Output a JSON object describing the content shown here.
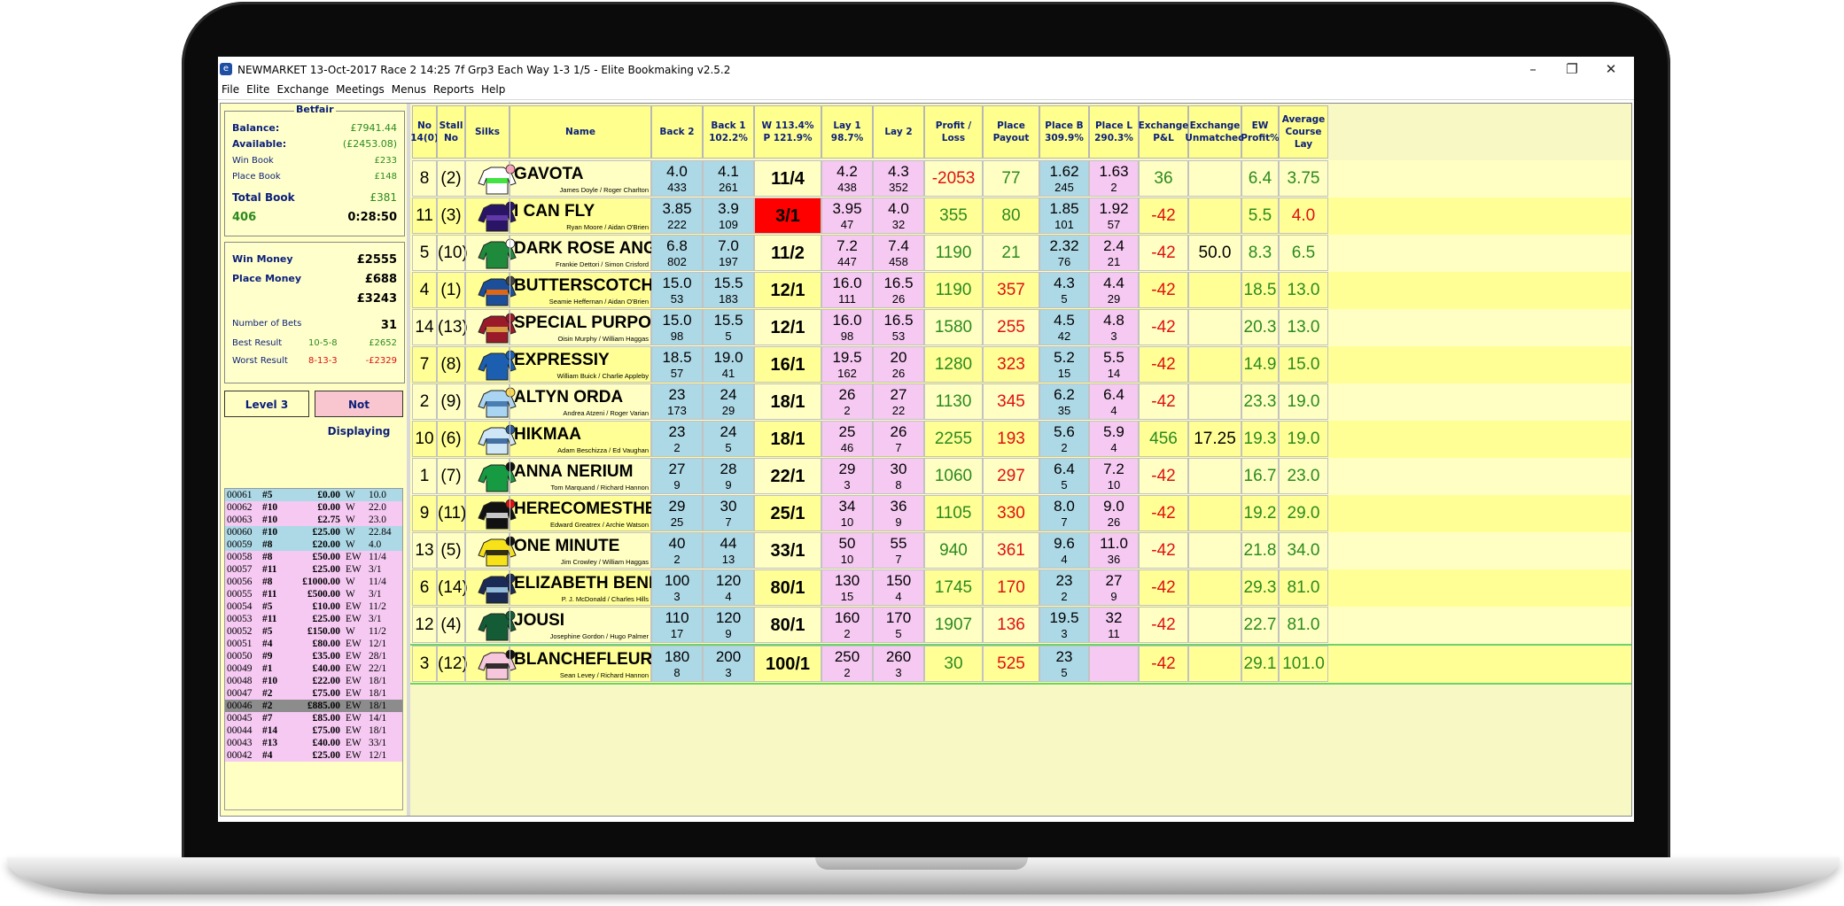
{
  "window": {
    "title": "NEWMARKET 13-Oct-2017 Race 2 14:25 7f Grp3 Each Way 1-3 1/5 - Elite Bookmaking v2.5.2",
    "minimize": "–",
    "restore": "❐",
    "close": "✕"
  },
  "menu": [
    "File",
    "Elite",
    "Exchange",
    "Meetings",
    "Menus",
    "Reports",
    "Help"
  ],
  "betfair": {
    "legend": "Betfair",
    "balance_label": "Balance:",
    "balance": "£7941.44",
    "available_label": "Available:",
    "available": "(£2453.08)",
    "winbook_label": "Win Book",
    "winbook": "£233",
    "placebook_label": "Place Book",
    "placebook": "£148",
    "totalbook_label": "Total Book",
    "totalbook": "£381",
    "count": "406",
    "timer": "0:28:50"
  },
  "money": {
    "win_label": "Win Money",
    "win": "£2555",
    "place_label": "Place Money",
    "place": "£688",
    "total": "£3243",
    "bets_label": "Number of Bets",
    "bets": "31",
    "best_label": "Best Result",
    "best_combo": "10-5-8",
    "best": "£2652",
    "worst_label": "Worst Result",
    "worst_combo": "8-13-3",
    "worst": "-£2329"
  },
  "buttons": {
    "level": "Level 3",
    "display": "Not Displaying"
  },
  "bets": [
    {
      "id": "00061",
      "h": "#5",
      "amt": "£0.00",
      "t": "W",
      "o": "10.0",
      "bg": "#add8e6"
    },
    {
      "id": "00062",
      "h": "#10",
      "amt": "£0.00",
      "t": "W",
      "o": "22.0",
      "bg": "#f5c9f2"
    },
    {
      "id": "00063",
      "h": "#10",
      "amt": "£2.75",
      "t": "W",
      "o": "23.0",
      "bg": "#f5c9f2"
    },
    {
      "id": "00060",
      "h": "#10",
      "amt": "£25.00",
      "t": "W",
      "o": "22.84",
      "bg": "#add8e6"
    },
    {
      "id": "00059",
      "h": "#8",
      "amt": "£20.00",
      "t": "W",
      "o": "4.0",
      "bg": "#add8e6"
    },
    {
      "id": "00058",
      "h": "#8",
      "amt": "£50.00",
      "t": "EW",
      "o": "11/4",
      "bg": "#f5c9f2"
    },
    {
      "id": "00057",
      "h": "#11",
      "amt": "£25.00",
      "t": "EW",
      "o": "3/1",
      "bg": "#f5c9f2"
    },
    {
      "id": "00056",
      "h": "#8",
      "amt": "£1000.00",
      "t": "W",
      "o": "11/4",
      "bg": "#f5c9f2"
    },
    {
      "id": "00055",
      "h": "#11",
      "amt": "£500.00",
      "t": "W",
      "o": "3/1",
      "bg": "#f5c9f2"
    },
    {
      "id": "00054",
      "h": "#5",
      "amt": "£10.00",
      "t": "EW",
      "o": "11/2",
      "bg": "#f5c9f2"
    },
    {
      "id": "00053",
      "h": "#11",
      "amt": "£25.00",
      "t": "EW",
      "o": "3/1",
      "bg": "#f5c9f2"
    },
    {
      "id": "00052",
      "h": "#5",
      "amt": "£150.00",
      "t": "W",
      "o": "11/2",
      "bg": "#f5c9f2"
    },
    {
      "id": "00051",
      "h": "#4",
      "amt": "£80.00",
      "t": "EW",
      "o": "12/1",
      "bg": "#f5c9f2"
    },
    {
      "id": "00050",
      "h": "#9",
      "amt": "£35.00",
      "t": "EW",
      "o": "28/1",
      "bg": "#f5c9f2"
    },
    {
      "id": "00049",
      "h": "#1",
      "amt": "£40.00",
      "t": "EW",
      "o": "22/1",
      "bg": "#f5c9f2"
    },
    {
      "id": "00048",
      "h": "#10",
      "amt": "£22.00",
      "t": "EW",
      "o": "18/1",
      "bg": "#f5c9f2"
    },
    {
      "id": "00047",
      "h": "#2",
      "amt": "£75.00",
      "t": "EW",
      "o": "18/1",
      "bg": "#f5c9f2"
    },
    {
      "id": "00046",
      "h": "#2",
      "amt": "£885.00",
      "t": "EW",
      "o": "18/1",
      "bg": "#8c8c8c"
    },
    {
      "id": "00045",
      "h": "#7",
      "amt": "£85.00",
      "t": "EW",
      "o": "14/1",
      "bg": "#f5c9f2"
    },
    {
      "id": "00044",
      "h": "#14",
      "amt": "£75.00",
      "t": "EW",
      "o": "18/1",
      "bg": "#f5c9f2"
    },
    {
      "id": "00043",
      "h": "#13",
      "amt": "£40.00",
      "t": "EW",
      "o": "33/1",
      "bg": "#f5c9f2"
    },
    {
      "id": "00042",
      "h": "#4",
      "amt": "£25.00",
      "t": "EW",
      "o": "12/1",
      "bg": "#f5c9f2"
    }
  ],
  "headers": [
    "No\n14(0)",
    "Stall\nNo",
    "Silks",
    "Name",
    "Back 2",
    "Back 1\n102.2%",
    "W 113.4%\nP 121.9%",
    "Lay 1\n98.7%",
    "Lay 2",
    "Profit /\nLoss",
    "Place\nPayout",
    "Place B\n309.9%",
    "Place L\n290.3%",
    "Exchange\nP&L",
    "Exchange\nUnmatched",
    "EW\nProfit%",
    "Average\nCourse\nLay"
  ],
  "runners": [
    {
      "no": "8",
      "stall": "(2)",
      "name": "GAVOTA",
      "jockey": "James Doyle / Roger Charlton",
      "b2": "4.0",
      "b2v": "433",
      "b1": "4.1",
      "b1v": "261",
      "odds": "11/4",
      "l1": "4.2",
      "l1v": "438",
      "l2": "4.3",
      "l2v": "352",
      "pl": "-2053",
      "pp": "77",
      "pb": "1.62",
      "pbv": "245",
      "pL": "1.63",
      "pLv": "2",
      "ex": "36",
      "exu": "",
      "ew": "6.4",
      "acl": "3.75",
      "silk": "#ffffff",
      "silk2": "#22dd22",
      "cap": "#ff9eb6"
    },
    {
      "no": "11",
      "stall": "(3)",
      "name": "I CAN FLY",
      "jockey": "Ryan Moore / Aidan O'Brien",
      "b2": "3.85",
      "b2v": "222",
      "b1": "3.9",
      "b1v": "109",
      "odds": "3/1",
      "l1": "3.95",
      "l1v": "47",
      "l2": "4.0",
      "l2v": "32",
      "pl": "355",
      "pp": "80",
      "pb": "1.85",
      "pbv": "101",
      "pL": "1.92",
      "pLv": "57",
      "ex": "-42",
      "exu": "",
      "ew": "5.5",
      "acl": "4.0",
      "silk": "#2a1466",
      "silk2": "#6a3fb2",
      "cap": "#2a1466"
    },
    {
      "no": "5",
      "stall": "(10)",
      "name": "DARK ROSE ANGEL",
      "jockey": "Frankie Dettori / Simon Crisford",
      "b2": "6.8",
      "b2v": "802",
      "b1": "7.0",
      "b1v": "197",
      "odds": "11/2",
      "l1": "7.2",
      "l1v": "447",
      "l2": "7.4",
      "l2v": "458",
      "pl": "1190",
      "pp": "21",
      "pb": "2.32",
      "pbv": "76",
      "pL": "2.4",
      "pLv": "21",
      "ex": "-42",
      "exu": "50.0",
      "ew": "8.3",
      "acl": "6.5",
      "silk": "#1f8a3c",
      "silk2": "#1f8a3c",
      "cap": "#ffffff"
    },
    {
      "no": "4",
      "stall": "(1)",
      "name": "BUTTERSCOTCH",
      "jockey": "Seamie Heffernan / Aidan O'Brien",
      "b2": "15.0",
      "b2v": "53",
      "b1": "15.5",
      "b1v": "183",
      "odds": "12/1",
      "l1": "16.0",
      "l1v": "111",
      "l2": "16.5",
      "l2v": "26",
      "pl": "1190",
      "pp": "357",
      "pb": "4.3",
      "pbv": "5",
      "pL": "4.4",
      "pLv": "29",
      "ex": "-42",
      "exu": "",
      "ew": "18.5",
      "acl": "13.0",
      "silk": "#1b4f9a",
      "silk2": "#ff6a00",
      "cap": "#444444"
    },
    {
      "no": "14",
      "stall": "(13)",
      "name": "SPECIAL PURPOSE",
      "jockey": "Oisin Murphy / William Haggas",
      "b2": "15.0",
      "b2v": "98",
      "b1": "15.5",
      "b1v": "5",
      "odds": "12/1",
      "l1": "16.0",
      "l1v": "98",
      "l2": "16.5",
      "l2v": "53",
      "pl": "1580",
      "pp": "255",
      "pb": "4.5",
      "pbv": "42",
      "pL": "4.8",
      "pLv": "3",
      "ex": "-42",
      "exu": "",
      "ew": "20.3",
      "acl": "13.0",
      "silk": "#9a1a2a",
      "silk2": "#e2b24a",
      "cap": "#9a1a2a"
    },
    {
      "no": "7",
      "stall": "(8)",
      "name": "EXPRESSIY",
      "jockey": "William Buick / Charlie Appleby",
      "b2": "18.5",
      "b2v": "57",
      "b1": "19.0",
      "b1v": "41",
      "odds": "16/1",
      "l1": "19.5",
      "l1v": "162",
      "l2": "20",
      "l2v": "26",
      "pl": "1280",
      "pp": "323",
      "pb": "5.2",
      "pbv": "15",
      "pL": "5.5",
      "pLv": "14",
      "ex": "-42",
      "exu": "",
      "ew": "14.9",
      "acl": "15.0",
      "silk": "#1c5fb0",
      "silk2": "#1c5fb0",
      "cap": "#1c5fb0"
    },
    {
      "no": "2",
      "stall": "(9)",
      "name": "ALTYN ORDA",
      "jockey": "Andrea Atzeni / Roger Varian",
      "b2": "23",
      "b2v": "173",
      "b1": "24",
      "b1v": "29",
      "odds": "18/1",
      "l1": "26",
      "l1v": "2",
      "l2": "27",
      "l2v": "22",
      "pl": "1130",
      "pp": "345",
      "pb": "6.2",
      "pbv": "35",
      "pL": "6.4",
      "pLv": "4",
      "ex": "-42",
      "exu": "",
      "ew": "23.3",
      "acl": "19.0",
      "silk": "#a9d4f2",
      "silk2": "#3a6ea8",
      "cap": "#ffd84a"
    },
    {
      "no": "10",
      "stall": "(6)",
      "name": "HIKMAA",
      "jockey": "Adam Beschizza / Ed Vaughan",
      "b2": "23",
      "b2v": "2",
      "b1": "24",
      "b1v": "5",
      "odds": "18/1",
      "l1": "25",
      "l1v": "46",
      "l2": "26",
      "l2v": "7",
      "pl": "2255",
      "pp": "193",
      "pb": "5.6",
      "pbv": "2",
      "pL": "5.9",
      "pLv": "4",
      "ex": "456",
      "exu": "17.25",
      "ew": "19.3",
      "acl": "19.0",
      "silk": "#cfe6f7",
      "silk2": "#2b5a94",
      "cap": "#2b5a94"
    },
    {
      "no": "1",
      "stall": "(7)",
      "name": "ANNA NERIUM",
      "jockey": "Tom Marquand / Richard Hannon",
      "b2": "27",
      "b2v": "9",
      "b1": "28",
      "b1v": "9",
      "odds": "22/1",
      "l1": "29",
      "l1v": "3",
      "l2": "30",
      "l2v": "8",
      "pl": "1060",
      "pp": "297",
      "pb": "6.4",
      "pbv": "5",
      "pL": "7.2",
      "pLv": "10",
      "ex": "-42",
      "exu": "",
      "ew": "16.7",
      "acl": "23.0",
      "silk": "#169a42",
      "silk2": "#169a42",
      "cap": "#111111"
    },
    {
      "no": "9",
      "stall": "(11)",
      "name": "HERECOMESTHESUN",
      "jockey": "Edward Greatrex / Archie Watson",
      "b2": "29",
      "b2v": "25",
      "b1": "30",
      "b1v": "7",
      "odds": "25/1",
      "l1": "34",
      "l1v": "10",
      "l2": "36",
      "l2v": "9",
      "pl": "1105",
      "pp": "330",
      "pb": "8.0",
      "pbv": "7",
      "pL": "9.0",
      "pLv": "26",
      "ex": "-42",
      "exu": "",
      "ew": "19.2",
      "acl": "29.0",
      "silk": "#111111",
      "silk2": "#e8e8e8",
      "cap": "#e01010"
    },
    {
      "no": "13",
      "stall": "(5)",
      "name": "ONE MINUTE",
      "jockey": "Jim Crowley / William Haggas",
      "b2": "40",
      "b2v": "2",
      "b1": "44",
      "b1v": "13",
      "odds": "33/1",
      "l1": "50",
      "l1v": "10",
      "l2": "55",
      "l2v": "7",
      "pl": "940",
      "pp": "361",
      "pb": "9.6",
      "pbv": "4",
      "pL": "11.0",
      "pLv": "36",
      "ex": "-42",
      "exu": "",
      "ew": "21.8",
      "acl": "34.0",
      "silk": "#f7e21a",
      "silk2": "#111111",
      "cap": "#111111"
    },
    {
      "no": "6",
      "stall": "(14)",
      "name": "ELIZABETH BENNET",
      "jockey": "P. J. McDonald / Charles Hills",
      "b2": "100",
      "b2v": "3",
      "b1": "120",
      "b1v": "4",
      "odds": "80/1",
      "l1": "130",
      "l1v": "15",
      "l2": "150",
      "l2v": "4",
      "pl": "1745",
      "pp": "170",
      "pb": "23",
      "pbv": "2",
      "pL": "27",
      "pLv": "9",
      "ex": "-42",
      "exu": "",
      "ew": "29.3",
      "acl": "81.0",
      "silk": "#1b2a55",
      "silk2": "#a9d4f2",
      "cap": "#1b2a55"
    },
    {
      "no": "12",
      "stall": "(4)",
      "name": "JOUSI",
      "jockey": "Josephine Gordon / Hugo Palmer",
      "b2": "110",
      "b2v": "17",
      "b1": "120",
      "b1v": "9",
      "odds": "80/1",
      "l1": "160",
      "l1v": "2",
      "l2": "170",
      "l2v": "5",
      "pl": "1907",
      "pp": "136",
      "pb": "19.5",
      "pbv": "3",
      "pL": "32",
      "pLv": "11",
      "ex": "-42",
      "exu": "",
      "ew": "22.7",
      "acl": "81.0",
      "silk": "#145c36",
      "silk2": "#145c36",
      "cap": "#145c36"
    },
    {
      "no": "3",
      "stall": "(12)",
      "name": "BLANCHEFLEUR",
      "jockey": "Sean Levey / Richard Hannon",
      "b2": "180",
      "b2v": "8",
      "b1": "200",
      "b1v": "3",
      "odds": "100/1",
      "l1": "250",
      "l1v": "2",
      "l2": "260",
      "l2v": "3",
      "pl": "30",
      "pp": "525",
      "pb": "23",
      "pbv": "5",
      "pL": "",
      "pLv": "",
      "ex": "-42",
      "exu": "",
      "ew": "29.1",
      "acl": "101.0",
      "silk": "#f6c6dc",
      "silk2": "#111111",
      "cap": "#111111"
    }
  ],
  "colors": {
    "green": "#2b8a1d",
    "red": "#e01010",
    "navy": "#0b1f7a",
    "back": "#add8e6",
    "lay": "#f5c9f2",
    "fav": "#ff0000"
  }
}
